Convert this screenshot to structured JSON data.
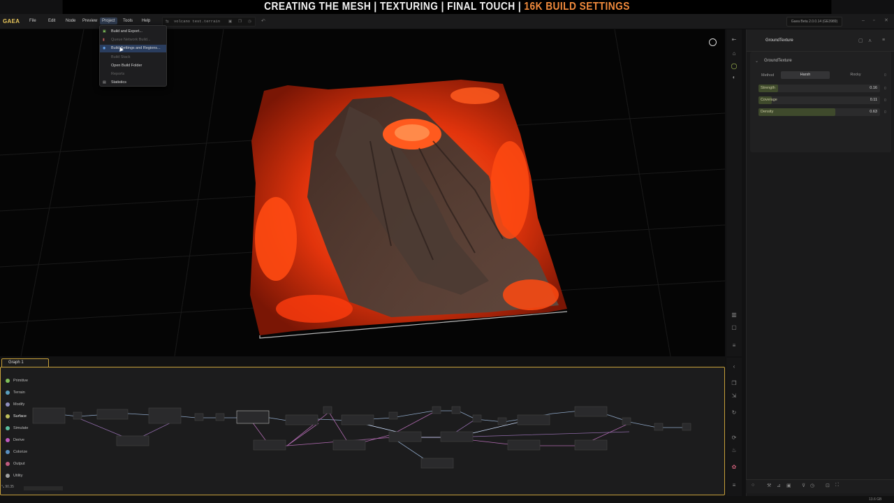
{
  "banner": {
    "part1": "CREATING THE MESH | TEXTURING | FINAL TOUCH |",
    "part2": "16K BUILD SETTINGS"
  },
  "app": {
    "logo": "GAEA",
    "menus": [
      "File",
      "Edit",
      "Node",
      "Preview",
      "Project",
      "Tools",
      "Help"
    ],
    "active_menu": "Project",
    "file_name": "volcano test.terrain",
    "version": "Gaea Beta 2.0.0.14 (GE3989)"
  },
  "project_menu": {
    "items": [
      {
        "label": "Build and Export...",
        "enabled": true
      },
      {
        "label": "Queue Network Build...",
        "enabled": false
      },
      {
        "label": "Build Settings and Regions...",
        "enabled": true,
        "selected": true
      },
      {
        "label": "Build Stack",
        "enabled": false
      },
      {
        "label": "Open Build Folder",
        "enabled": true
      },
      {
        "label": "Reports",
        "enabled": false
      },
      {
        "label": "Statistics",
        "enabled": true
      }
    ]
  },
  "properties": {
    "node_name": "GroundTexture",
    "group_title": "GroundTexture",
    "method_label": "Method",
    "method_options": [
      "Harsh",
      "Rocky"
    ],
    "method_selected": "Harsh",
    "params": [
      {
        "label": "Strength",
        "value": "0.16",
        "fraction": 0.16
      },
      {
        "label": "Coverage",
        "value": "0.11",
        "fraction": 0.11
      },
      {
        "label": "Density",
        "value": "0.63",
        "fraction": 0.63
      }
    ],
    "zero": "0"
  },
  "graph": {
    "tab_label": "Graph 1",
    "palette": [
      {
        "label": "Primitive",
        "color": "#7fbf5a"
      },
      {
        "label": "Terrain",
        "color": "#5aa0bf"
      },
      {
        "label": "Modify",
        "color": "#8f8fbf"
      },
      {
        "label": "Surface",
        "color": "#bfbf5a"
      },
      {
        "label": "Simulate",
        "color": "#5abf9f"
      },
      {
        "label": "Derive",
        "color": "#bf5abf"
      },
      {
        "label": "Colorize",
        "color": "#5a8fbf"
      },
      {
        "label": "Output",
        "color": "#bf5a7f"
      },
      {
        "label": "Utility",
        "color": "#9f9f9f"
      }
    ],
    "zoom": "90.35"
  },
  "status": {
    "memory": "13.6 GB"
  },
  "colors": {
    "accent": "#c9a23b",
    "lava": "#ff4a12",
    "menu_highlight": "#2a3d5e"
  }
}
